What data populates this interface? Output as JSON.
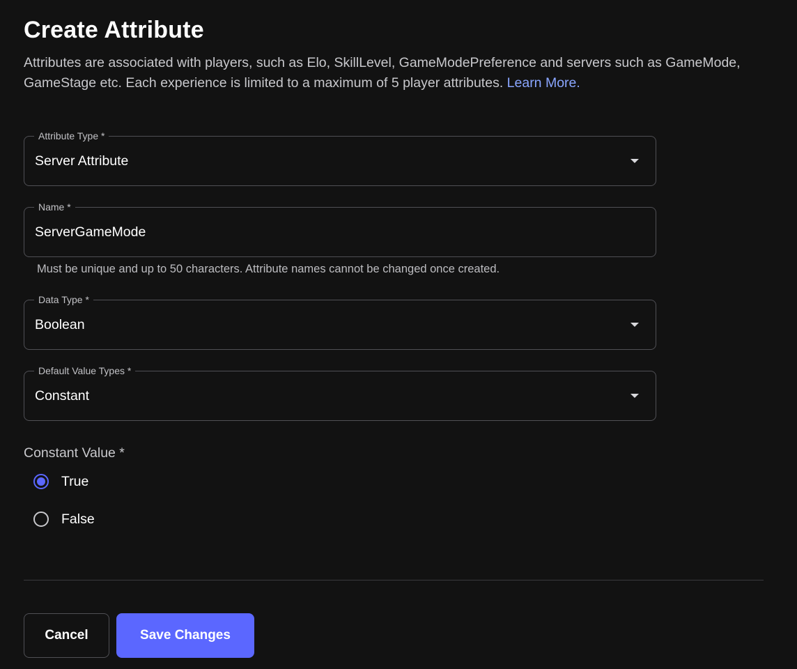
{
  "header": {
    "title": "Create Attribute",
    "description": "Attributes are associated with players, such as Elo, SkillLevel, GameModePreference and servers such as GameMode, GameStage etc. Each experience is limited to a maximum of 5 player attributes.",
    "learn_more": "Learn More."
  },
  "form": {
    "attribute_type": {
      "label": "Attribute Type *",
      "value": "Server Attribute",
      "icon": "chevron-down-icon"
    },
    "name": {
      "label": "Name *",
      "value": "ServerGameMode",
      "helper": "Must be unique and up to 50 characters. Attribute names cannot be changed once created."
    },
    "data_type": {
      "label": "Data Type *",
      "value": "Boolean",
      "icon": "chevron-down-icon"
    },
    "default_value_types": {
      "label": "Default Value Types *",
      "value": "Constant",
      "icon": "chevron-down-icon"
    },
    "constant_value": {
      "label": "Constant Value *",
      "options": [
        {
          "label": "True",
          "checked": true
        },
        {
          "label": "False",
          "checked": false
        }
      ]
    }
  },
  "actions": {
    "cancel_label": "Cancel",
    "save_label": "Save Changes"
  },
  "colors": {
    "background": "#121212",
    "accent": "#5b67ff",
    "link": "#8aa6ff",
    "border": "#505055"
  }
}
